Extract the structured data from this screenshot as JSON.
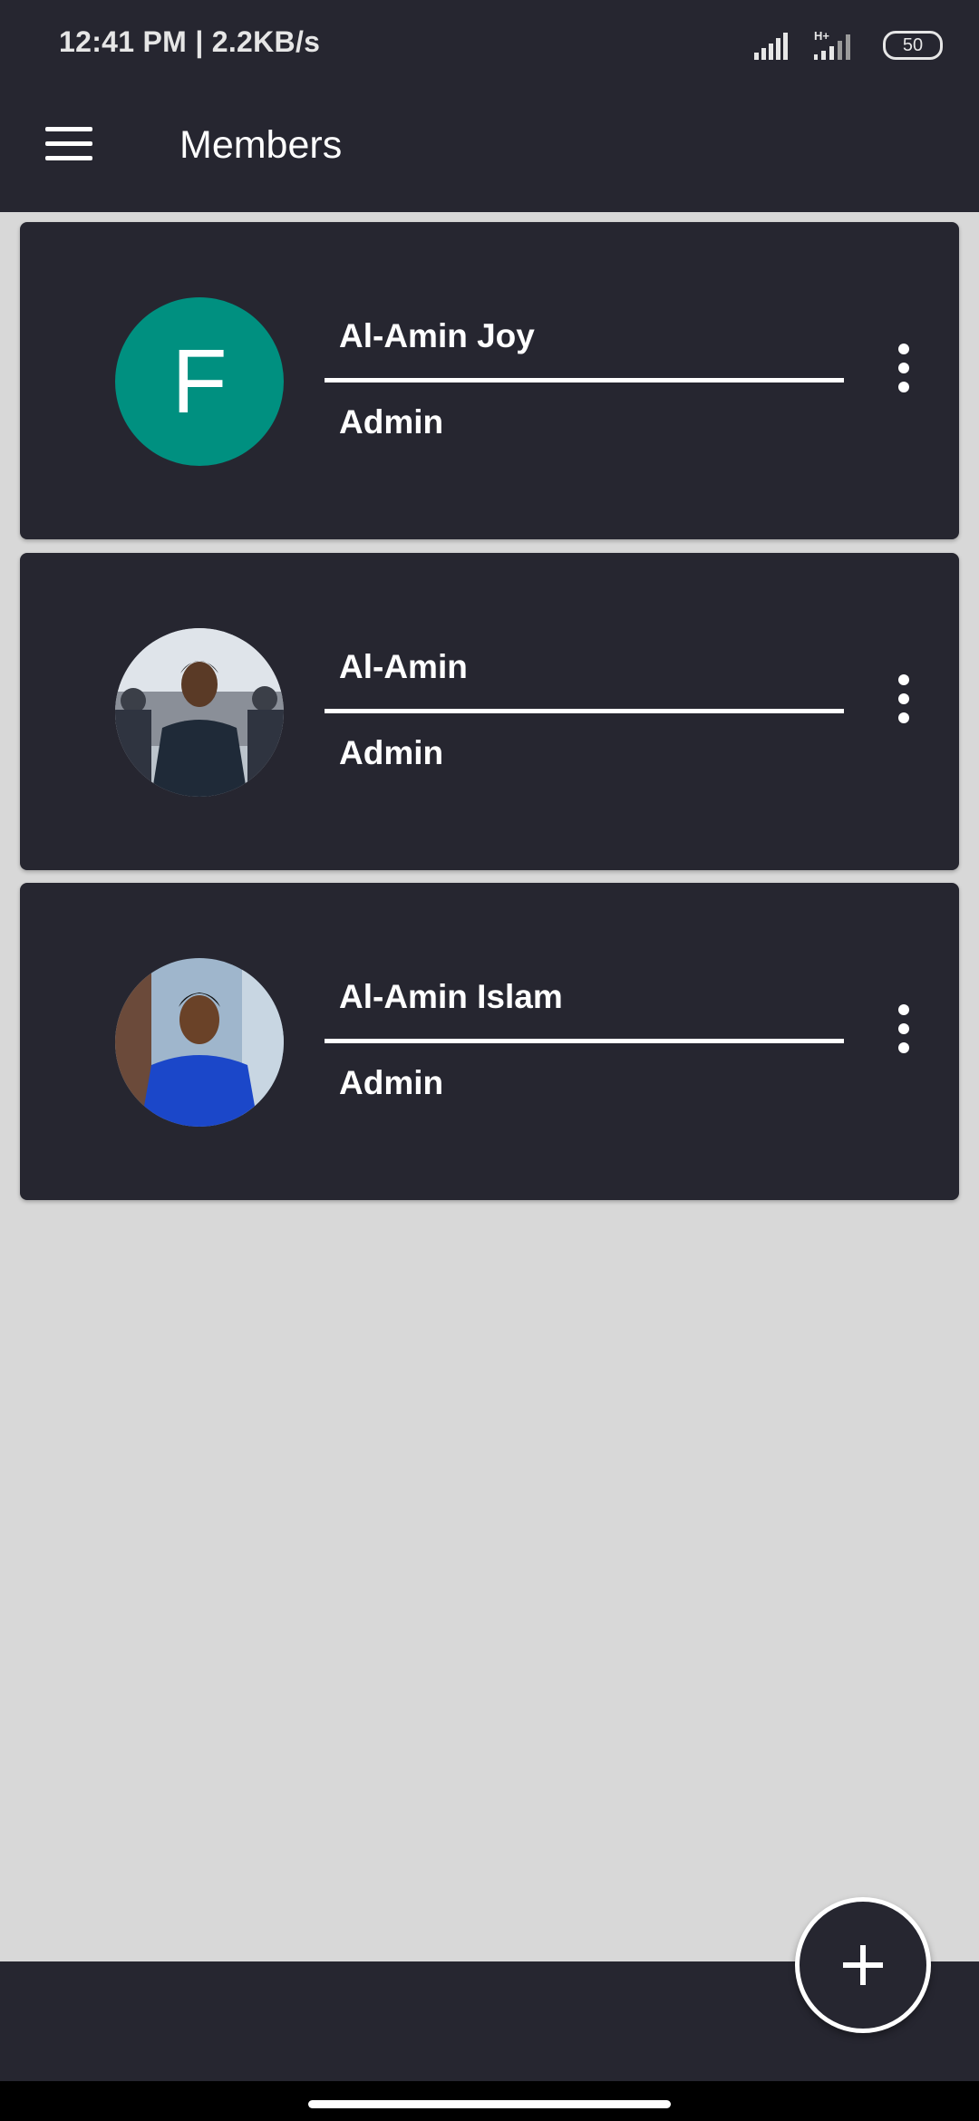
{
  "status_bar": {
    "text": "12:41 PM | 2.2KB/s",
    "network_label": "H+",
    "battery": "50"
  },
  "app_bar": {
    "title": "Members",
    "menu_icon": "hamburger-menu-icon"
  },
  "members": [
    {
      "name": "Al-Amin Joy",
      "role": "Admin",
      "avatar_letter": "F",
      "avatar_color": "#009080"
    },
    {
      "name": "Al-Amin",
      "role": "Admin"
    },
    {
      "name": "Al-Amin Islam",
      "role": "Admin"
    }
  ],
  "fab": {
    "icon": "plus-icon"
  },
  "colors": {
    "background": "#d8d8d8",
    "surface": "#262630",
    "text": "#ffffff",
    "avatar_teal": "#009080"
  }
}
